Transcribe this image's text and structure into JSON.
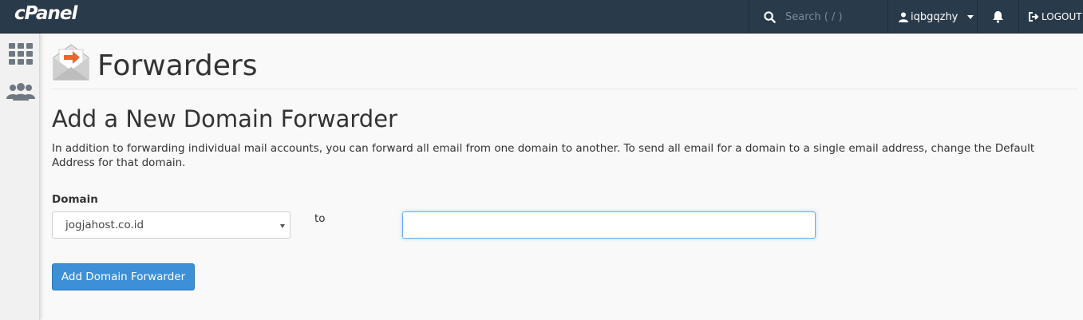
{
  "header": {
    "logo_text": "cPanel",
    "search": {
      "placeholder": "Search ( / )",
      "value": ""
    },
    "username": "iqbgqzhy",
    "logout_label": "LOGOUT"
  },
  "sidebar": {
    "items": [
      {
        "icon": "grid-icon"
      },
      {
        "icon": "users-icon"
      }
    ]
  },
  "page": {
    "title": "Forwarders",
    "section_title": "Add a New Domain Forwarder",
    "description": "In addition to forwarding individual mail accounts, you can forward all email from one domain to another. To send all email for a domain to a single email address, change the Default Address for that domain.",
    "form": {
      "domain_label": "Domain",
      "domain_value": "jogjahost.co.id",
      "to_label": "to",
      "destination_value": "",
      "submit_label": "Add Domain Forwarder"
    }
  },
  "colors": {
    "topbar": "#293a4a",
    "accent_orange": "#f26522",
    "button_blue": "#3d8fd6"
  }
}
